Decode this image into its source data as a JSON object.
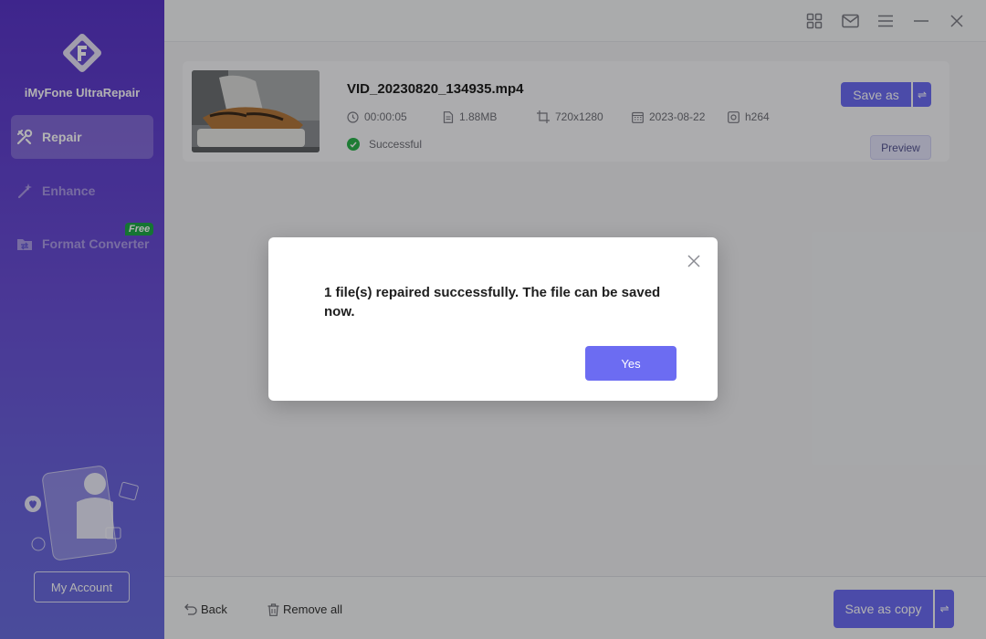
{
  "sidebar": {
    "app_name": "iMyFone UltraRepair",
    "logo_icon": "ultrarepair-logo-icon",
    "items": [
      {
        "label": "Repair",
        "icon": "repair-tools-icon",
        "active": true
      },
      {
        "label": "Enhance",
        "icon": "magic-wand-icon",
        "active": false
      },
      {
        "label": "Format Converter",
        "icon": "format-converter-icon",
        "active": false,
        "badge": "Free"
      }
    ],
    "account_label": "My Account"
  },
  "titlebar": {
    "icons": [
      "grid-icon",
      "mail-icon",
      "menu-icon",
      "minimize-icon",
      "close-icon"
    ]
  },
  "file": {
    "name": "VID_20230820_134935.mp4",
    "duration": "00:00:05",
    "size": "1.88MB",
    "resolution": "720x1280",
    "date": "2023-08-22",
    "codec": "h264",
    "status": "Successful",
    "save_as_label": "Save as",
    "preview_label": "Preview"
  },
  "bottombar": {
    "back_label": "Back",
    "remove_all_label": "Remove all",
    "save_copy_label": "Save as copy"
  },
  "dialog": {
    "message": "1 file(s) repaired successfully. The file can be saved now.",
    "yes_label": "Yes"
  },
  "colors": {
    "accent": "#6c6cf2",
    "sidebar_top": "#5a36c9",
    "sidebar_bottom": "#6a6ddf",
    "success": "#2bb24c",
    "free_badge": "#1fa84a"
  }
}
